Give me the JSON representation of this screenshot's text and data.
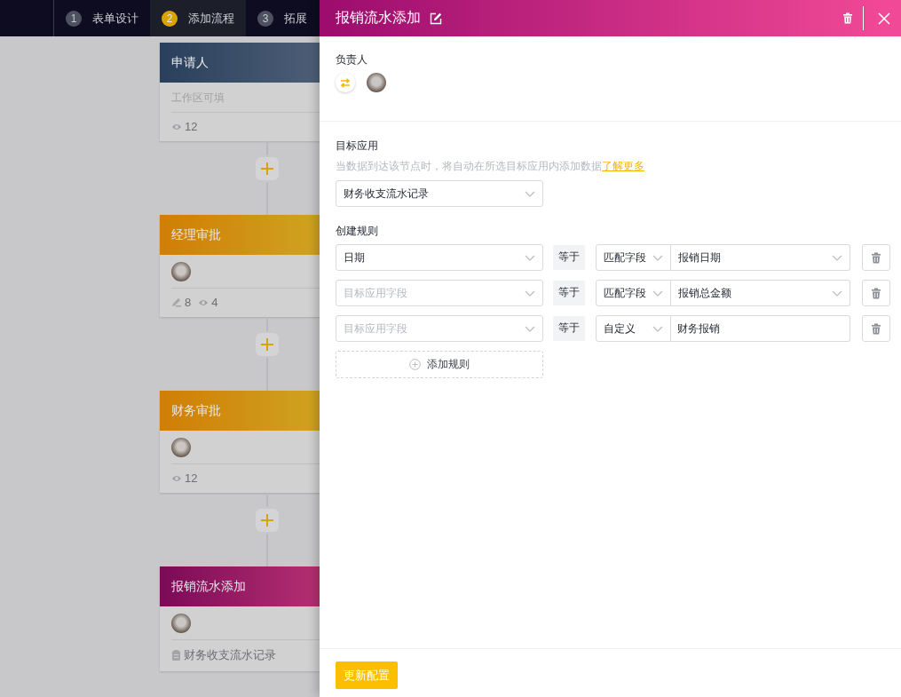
{
  "steps": [
    {
      "number": "1",
      "label": "表单设计",
      "selected": false
    },
    {
      "number": "2",
      "label": "添加流程",
      "selected": true
    },
    {
      "number": "3",
      "label": "拓展",
      "selected": false
    }
  ],
  "flow_nodes": [
    {
      "kind": "applicant",
      "title": "申请人",
      "note": "工作区可填",
      "avatar": false,
      "stats": [
        {
          "kind": "view",
          "value": "12"
        }
      ]
    },
    {
      "kind": "approval",
      "title": "经理审批",
      "avatar": true,
      "stats": [
        {
          "kind": "edit",
          "value": "8"
        },
        {
          "kind": "view",
          "value": "4"
        }
      ]
    },
    {
      "kind": "approval",
      "title": "财务审批",
      "avatar": true,
      "stats": [
        {
          "kind": "view",
          "value": "12"
        }
      ]
    },
    {
      "kind": "data_add",
      "title": "报销流水添加",
      "avatar": true,
      "stats": [
        {
          "kind": "app",
          "value": "财务收支流水记录"
        }
      ]
    }
  ],
  "panel": {
    "title": "报销流水添加",
    "owner": {
      "label": "负责人",
      "avatar": true
    },
    "target": {
      "label": "目标应用",
      "hint": "当数据到达该节点时，将自动在所选目标应用内添加数据",
      "link": "了解更多",
      "value": "财务收支流水记录"
    },
    "rules": {
      "label": "创建规则",
      "add_label": "添加规则",
      "rows": [
        {
          "field": {
            "value": "日期"
          },
          "operator": "等于",
          "mode": {
            "kind": "match",
            "label": "匹配字段"
          },
          "value": "报销日期"
        },
        {
          "field": {
            "placeholder": "目标应用字段"
          },
          "operator": "等于",
          "mode": {
            "kind": "match",
            "label": "匹配字段"
          },
          "value": "报销总金额"
        },
        {
          "field": {
            "placeholder": "目标应用字段"
          },
          "operator": "等于",
          "mode": {
            "kind": "custom",
            "label": "自定义"
          },
          "value": "财务报销"
        }
      ]
    },
    "submit": "更新配置"
  }
}
